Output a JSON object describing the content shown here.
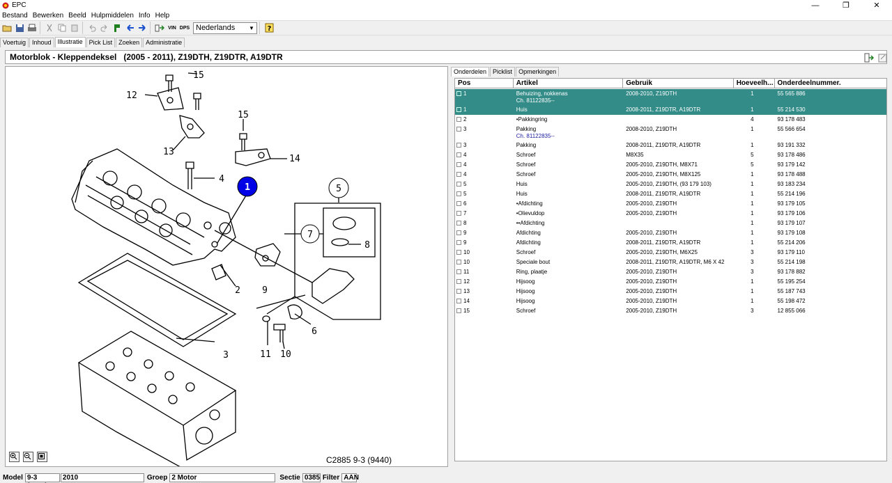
{
  "window": {
    "title": "EPC"
  },
  "menu": [
    "Bestand",
    "Bewerken",
    "Beeld",
    "Hulpmiddelen",
    "Info",
    "Help"
  ],
  "toolbar": {
    "language": "Nederlands",
    "vin_label": "VIN",
    "dpr_label": "DPS"
  },
  "nav_tabs": [
    "Voertuig",
    "Inhoud",
    "Illustratie",
    "Pick List",
    "Zoeken",
    "Administratie"
  ],
  "header": {
    "title": "Motorblok - Kleppendeksel   (2005 - 2011), Z19DTH, Z19DTR, A19DTR"
  },
  "illustration": {
    "caption": "C2885 9-3 (9440)",
    "callouts": [
      "1",
      "2",
      "3",
      "4",
      "5",
      "6",
      "7",
      "8",
      "9",
      "10",
      "10",
      "11",
      "12",
      "13",
      "14",
      "15",
      "15"
    ]
  },
  "right_tabs": [
    "Onderdelen",
    "Picklist",
    "Opmerkingen"
  ],
  "parts": {
    "columns": [
      "Pos",
      "Artikel",
      "Gebruik",
      "Hoeveelh...",
      "Onderdeelnummer."
    ],
    "rows": [
      {
        "pos": "1",
        "artikel": "Behuizing, nokkenas",
        "gebruik": "2008-2010, Z19DTH",
        "qty": "1",
        "nr": "55 565 886",
        "sub": "Ch. 81122835--",
        "selected": true
      },
      {
        "pos": "1",
        "artikel": "Huis",
        "gebruik": "2008-2011, Z19DTR, A19DTR",
        "qty": "1",
        "nr": "55 214 530",
        "selected": true
      },
      {
        "pos": "2",
        "artikel": "•Pakkingring",
        "gebruik": "",
        "qty": "4",
        "nr": "93 178 483"
      },
      {
        "pos": "3",
        "artikel": "Pakking",
        "gebruik": "2008-2010, Z19DTH",
        "qty": "1",
        "nr": "55 566 654",
        "sub": "Ch. 81122835--"
      },
      {
        "pos": "3",
        "artikel": "Pakking",
        "gebruik": "2008-2011, Z19DTR, A19DTR",
        "qty": "1",
        "nr": "93 191 332"
      },
      {
        "pos": "4",
        "artikel": "Schroef",
        "gebruik": "M8X35",
        "qty": "5",
        "nr": "93 178 486"
      },
      {
        "pos": "4",
        "artikel": "Schroef",
        "gebruik": "2005-2010, Z19DTH, M8X71",
        "qty": "5",
        "nr": "93 179 142"
      },
      {
        "pos": "4",
        "artikel": "Schroef",
        "gebruik": "2005-2010, Z19DTH, M8X125",
        "qty": "1",
        "nr": "93 178 488"
      },
      {
        "pos": "5",
        "artikel": "Huis",
        "gebruik": "2005-2010, Z19DTH, (93 179 103)",
        "qty": "1",
        "nr": "93 183 234"
      },
      {
        "pos": "5",
        "artikel": "Huis",
        "gebruik": "2008-2011, Z19DTR, A19DTR",
        "qty": "1",
        "nr": "55 214 196"
      },
      {
        "pos": "6",
        "artikel": "•Afdichting",
        "gebruik": "2005-2010, Z19DTH",
        "qty": "1",
        "nr": "93 179 105"
      },
      {
        "pos": "7",
        "artikel": "•Olievuldop",
        "gebruik": "2005-2010, Z19DTH",
        "qty": "1",
        "nr": "93 179 106"
      },
      {
        "pos": "8",
        "artikel": "••Afdichting",
        "gebruik": "",
        "qty": "1",
        "nr": "93 179 107"
      },
      {
        "pos": "9",
        "artikel": "Afdichting",
        "gebruik": "2005-2010, Z19DTH",
        "qty": "1",
        "nr": "93 179 108"
      },
      {
        "pos": "9",
        "artikel": "Afdichting",
        "gebruik": "2008-2011, Z19DTR, A19DTR",
        "qty": "1",
        "nr": "55 214 206"
      },
      {
        "pos": "10",
        "artikel": "Schroef",
        "gebruik": "2005-2010, Z19DTH, M6X25",
        "qty": "3",
        "nr": "93 179 110"
      },
      {
        "pos": "10",
        "artikel": "Speciale bout",
        "gebruik": "2008-2011, Z19DTR, A19DTR, M6 X 42",
        "qty": "3",
        "nr": "55 214 198"
      },
      {
        "pos": "11",
        "artikel": "Ring, plaatje",
        "gebruik": "2005-2010, Z19DTH",
        "qty": "3",
        "nr": "93 178 882"
      },
      {
        "pos": "12",
        "artikel": "Hijsoog",
        "gebruik": "2005-2010, Z19DTH",
        "qty": "1",
        "nr": "55 195 254"
      },
      {
        "pos": "13",
        "artikel": "Hijsoog",
        "gebruik": "2005-2010, Z19DTH",
        "qty": "1",
        "nr": "55 187 743"
      },
      {
        "pos": "14",
        "artikel": "Hijsoog",
        "gebruik": "2005-2010, Z19DTH",
        "qty": "1",
        "nr": "55 198 472"
      },
      {
        "pos": "15",
        "artikel": "Schroef",
        "gebruik": "2005-2010, Z19DTH",
        "qty": "3",
        "nr": "12 855 066"
      }
    ]
  },
  "status": {
    "model_label": "Model",
    "model_value": "9-3 (9440)",
    "year_value": "2010",
    "groep_label": "Groep",
    "groep_value": "2 Motor",
    "sectie_label": "Sectie",
    "sectie_value": "0385",
    "filter_label": "Filter",
    "filter_value": "AAN"
  },
  "colors": {
    "selected_row": "#338c88",
    "callout_highlight": "#0000e6"
  }
}
